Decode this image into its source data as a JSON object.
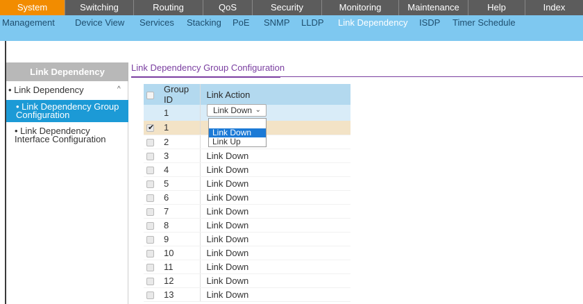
{
  "topnav": {
    "tabs": [
      {
        "label": "System",
        "active": true
      },
      {
        "label": "Switching",
        "active": false
      },
      {
        "label": "Routing",
        "active": false
      },
      {
        "label": "QoS",
        "active": false
      },
      {
        "label": "Security",
        "active": false
      },
      {
        "label": "Monitoring",
        "active": false
      },
      {
        "label": "Maintenance",
        "active": false
      },
      {
        "label": "Help",
        "active": false
      },
      {
        "label": "Index",
        "active": false
      }
    ]
  },
  "subnav": {
    "items": [
      {
        "label": "Management"
      },
      {
        "label": "Device View"
      },
      {
        "label": "Services"
      },
      {
        "label": "Stacking"
      },
      {
        "label": "PoE"
      },
      {
        "label": "SNMP"
      },
      {
        "label": "LLDP"
      },
      {
        "label": "Link Dependency",
        "active": true
      },
      {
        "label": "ISDP"
      },
      {
        "label": "Timer Schedule"
      }
    ]
  },
  "sidebar": {
    "header": "Link Dependency",
    "group_label": "• Link Dependency",
    "caret": "^",
    "items": [
      {
        "label": "• Link Dependency Group Configuration",
        "active": true
      },
      {
        "label": "• Link Dependency Interface Configuration",
        "active": false
      }
    ]
  },
  "section": {
    "title": "Link Dependency Group Configuration"
  },
  "table": {
    "headers": {
      "group_id": "Group ID",
      "link_action": "Link Action"
    },
    "edit_row": {
      "group_id": "1",
      "select_value": "Link Down"
    },
    "dropdown_options": [
      "Link Down",
      "Link Up"
    ],
    "rows": [
      {
        "group_id": "1",
        "link_action": "",
        "checked": true
      },
      {
        "group_id": "2",
        "link_action": "",
        "checked": false
      },
      {
        "group_id": "3",
        "link_action": "Link Down",
        "checked": false
      },
      {
        "group_id": "4",
        "link_action": "Link Down",
        "checked": false
      },
      {
        "group_id": "5",
        "link_action": "Link Down",
        "checked": false
      },
      {
        "group_id": "6",
        "link_action": "Link Down",
        "checked": false
      },
      {
        "group_id": "7",
        "link_action": "Link Down",
        "checked": false
      },
      {
        "group_id": "8",
        "link_action": "Link Down",
        "checked": false
      },
      {
        "group_id": "9",
        "link_action": "Link Down",
        "checked": false
      },
      {
        "group_id": "10",
        "link_action": "Link Down",
        "checked": false
      },
      {
        "group_id": "11",
        "link_action": "Link Down",
        "checked": false
      },
      {
        "group_id": "12",
        "link_action": "Link Down",
        "checked": false
      },
      {
        "group_id": "13",
        "link_action": "Link Down",
        "checked": false
      }
    ]
  },
  "colors": {
    "top_tab_active": "#f28c00",
    "subnav_bg": "#7ec8f0",
    "sidebar_active": "#1c9ad6",
    "section_title": "#7a3ea0",
    "table_header": "#b3d9ef",
    "selected_row": "#f3e3c6"
  }
}
